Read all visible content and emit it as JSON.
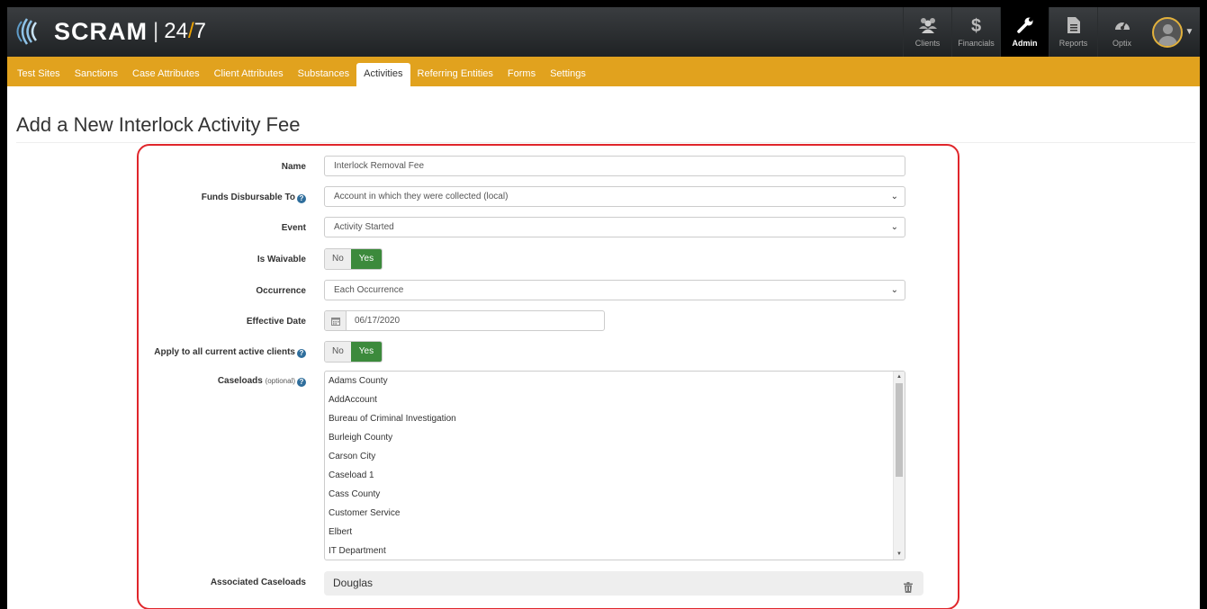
{
  "app": {
    "brand": "SCRAM",
    "brand_suffix": "24/7",
    "brand_suffix_a": "24",
    "brand_suffix_slash": "/",
    "brand_suffix_b": "7",
    "divider": "|"
  },
  "topnav": {
    "items": [
      {
        "label": "Clients",
        "icon": "users-icon",
        "active": false
      },
      {
        "label": "Financials",
        "icon": "dollar-icon",
        "active": false
      },
      {
        "label": "Admin",
        "icon": "wrench-icon",
        "active": true
      },
      {
        "label": "Reports",
        "icon": "document-icon",
        "active": false
      },
      {
        "label": "Optix",
        "icon": "gauge-icon",
        "active": false
      }
    ]
  },
  "subnav": {
    "items": [
      {
        "label": "Test Sites",
        "active": false
      },
      {
        "label": "Sanctions",
        "active": false
      },
      {
        "label": "Case Attributes",
        "active": false
      },
      {
        "label": "Client Attributes",
        "active": false
      },
      {
        "label": "Substances",
        "active": false
      },
      {
        "label": "Activities",
        "active": true
      },
      {
        "label": "Referring Entities",
        "active": false
      },
      {
        "label": "Forms",
        "active": false
      },
      {
        "label": "Settings",
        "active": false
      }
    ]
  },
  "page": {
    "title": "Add a New Interlock Activity Fee"
  },
  "form": {
    "name": {
      "label": "Name",
      "value": "Interlock Removal Fee"
    },
    "funds": {
      "label": "Funds Disbursable To",
      "value": "Account in which they were collected (local)"
    },
    "event": {
      "label": "Event",
      "value": "Activity Started"
    },
    "waivable": {
      "label": "Is Waivable",
      "no": "No",
      "yes": "Yes",
      "selected": "Yes"
    },
    "occurrence": {
      "label": "Occurrence",
      "value": "Each Occurrence"
    },
    "effective_date": {
      "label": "Effective Date",
      "value": "06/17/2020"
    },
    "apply_all": {
      "label": "Apply to all current active clients",
      "no": "No",
      "yes": "Yes",
      "selected": "Yes"
    },
    "caseloads": {
      "label": "Caseloads",
      "optional": "(optional)",
      "options": [
        "Adams County",
        "AddAccount",
        "Bureau of Criminal Investigation",
        "Burleigh County",
        "Carson City",
        "Caseload 1",
        "Cass County",
        "Customer Service",
        "Elbert",
        "IT Department"
      ]
    },
    "associated": {
      "label": "Associated Caseloads",
      "value": "Douglas"
    }
  },
  "colors": {
    "subnav": "#e1a21e",
    "toggle_yes": "#3c8a3c",
    "highlight": "#e0262b",
    "topbar": "#2b2e30"
  }
}
